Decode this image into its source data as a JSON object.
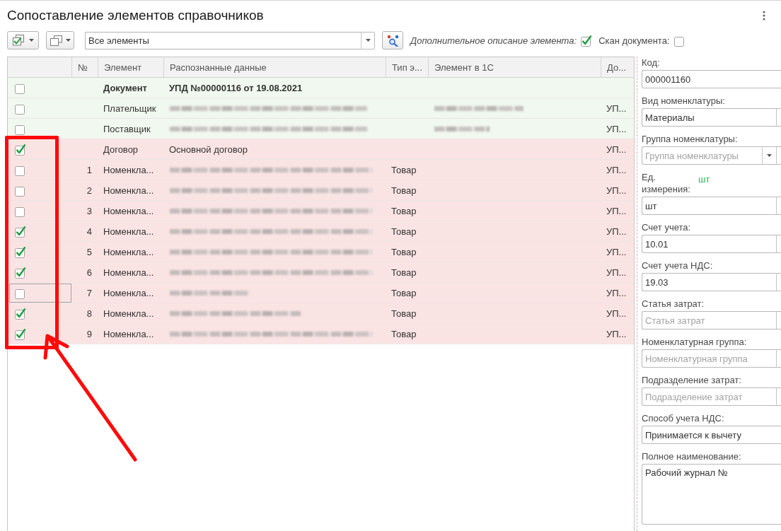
{
  "window": {
    "title": "Сопоставление элементов справочников"
  },
  "toolbar": {
    "filter": {
      "value": "Все элементы"
    },
    "extra_description": {
      "label": "Дополнительное описание элемента:",
      "checked": true
    },
    "document_scan": {
      "label": "Скан документа:",
      "checked": false
    }
  },
  "table": {
    "columns": [
      "№",
      "Элемент",
      "Распознанные данные",
      "Тип э...",
      "Элемент в 1С",
      "До..."
    ],
    "rows": [
      {
        "kind": "document",
        "checked": false,
        "selected": false,
        "color": "#f1f8ef",
        "element": "Документ",
        "recognized_data": "УПД №00000116 от 19.08.2021",
        "recognized_blurred": false,
        "element_1c_blurred": false
      },
      {
        "kind": "entry",
        "checked": false,
        "selected": false,
        "color": "#f1f8ef",
        "element": "Плательщик",
        "recognized_blurred": true,
        "element_1c_blurred": true,
        "document": "УП..."
      },
      {
        "kind": "entry",
        "checked": false,
        "selected": false,
        "color": "#f1f8ef",
        "element": "Поставщик",
        "recognized_blurred": true,
        "element_1c_blurred": true,
        "document": "УП..."
      },
      {
        "kind": "entry",
        "checked": true,
        "selected": false,
        "color": "#fae4e3",
        "element": "Договор",
        "recognized_data": "Основной договор",
        "recognized_blurred": false,
        "element_1c_blurred": false,
        "document": "УП..."
      },
      {
        "kind": "entry",
        "checked": false,
        "selected": false,
        "color": "#fae4e3",
        "number": "1",
        "element": "Номенкла...",
        "recognized_blurred": true,
        "type": "Товар",
        "element_1c_blurred": false,
        "document": "УП..."
      },
      {
        "kind": "entry",
        "checked": false,
        "selected": false,
        "color": "#fae4e3",
        "number": "2",
        "element": "Номенкла...",
        "recognized_blurred": true,
        "type": "Товар",
        "element_1c_blurred": false,
        "document": "УП..."
      },
      {
        "kind": "entry",
        "checked": false,
        "selected": false,
        "color": "#fae4e3",
        "number": "3",
        "element": "Номенкла...",
        "recognized_blurred": true,
        "type": "Товар",
        "element_1c_blurred": false,
        "document": "УП..."
      },
      {
        "kind": "entry",
        "checked": true,
        "selected": false,
        "color": "#fae4e3",
        "number": "4",
        "element": "Номенкла...",
        "recognized_blurred": true,
        "type": "Товар",
        "element_1c_blurred": false,
        "document": "УП..."
      },
      {
        "kind": "entry",
        "checked": true,
        "selected": false,
        "color": "#fae4e3",
        "number": "5",
        "element": "Номенкла...",
        "recognized_blurred": true,
        "type": "Товар",
        "element_1c_blurred": false,
        "document": "УП..."
      },
      {
        "kind": "entry",
        "checked": true,
        "selected": false,
        "color": "#fae4e3",
        "number": "6",
        "element": "Номенкла...",
        "recognized_blurred": true,
        "type": "Товар",
        "element_1c_blurred": false,
        "document": "УП..."
      },
      {
        "kind": "entry",
        "checked": false,
        "selected": true,
        "color": "#fae4e3",
        "number": "7",
        "element": "Номенкла...",
        "recognized_blurred": true,
        "type": "Товар",
        "element_1c_blurred": false,
        "document": "УП..."
      },
      {
        "kind": "entry",
        "checked": true,
        "selected": false,
        "color": "#fae4e3",
        "number": "8",
        "element": "Номенкла...",
        "recognized_blurred": true,
        "type": "Товар",
        "element_1c_blurred": false,
        "document": "УП..."
      },
      {
        "kind": "entry",
        "checked": true,
        "selected": false,
        "color": "#fae4e3",
        "number": "9",
        "element": "Номенкла...",
        "recognized_blurred": true,
        "type": "Товар",
        "element_1c_blurred": false,
        "document": "УП..."
      }
    ]
  },
  "details": {
    "fields": [
      {
        "kind": "text",
        "label": "Код:",
        "value": "000001160"
      },
      {
        "kind": "choice",
        "label": "Вид номенклатуры:",
        "value": "Материалы"
      },
      {
        "kind": "dropdown",
        "label": "Группа номенклатуры:",
        "placeholder": "Группа номенклатуры"
      },
      {
        "kind": "choice",
        "label": "Ед. измерения:",
        "note": "шт",
        "value": "шт"
      },
      {
        "kind": "choice",
        "label": "Счет учета:",
        "value": "10.01"
      },
      {
        "kind": "choice",
        "label": "Счет учета НДС:",
        "value": "19.03"
      },
      {
        "kind": "choice",
        "label": "Статья затрат:",
        "placeholder": "Статья затрат"
      },
      {
        "kind": "choice",
        "label": "Номенклатурная группа:",
        "placeholder": "Номенклатурная группа"
      },
      {
        "kind": "choice",
        "label": "Подразделение затрат:",
        "placeholder": "Подразделение затрат"
      },
      {
        "kind": "text",
        "label": "Способ учета НДС:",
        "value": "Принимается к вычету"
      },
      {
        "kind": "textarea",
        "label": "Полное наименование:",
        "value": "Рабочий журнал №"
      }
    ]
  },
  "annotations": [
    {
      "kind": "frame"
    },
    {
      "kind": "arrow"
    }
  ]
}
